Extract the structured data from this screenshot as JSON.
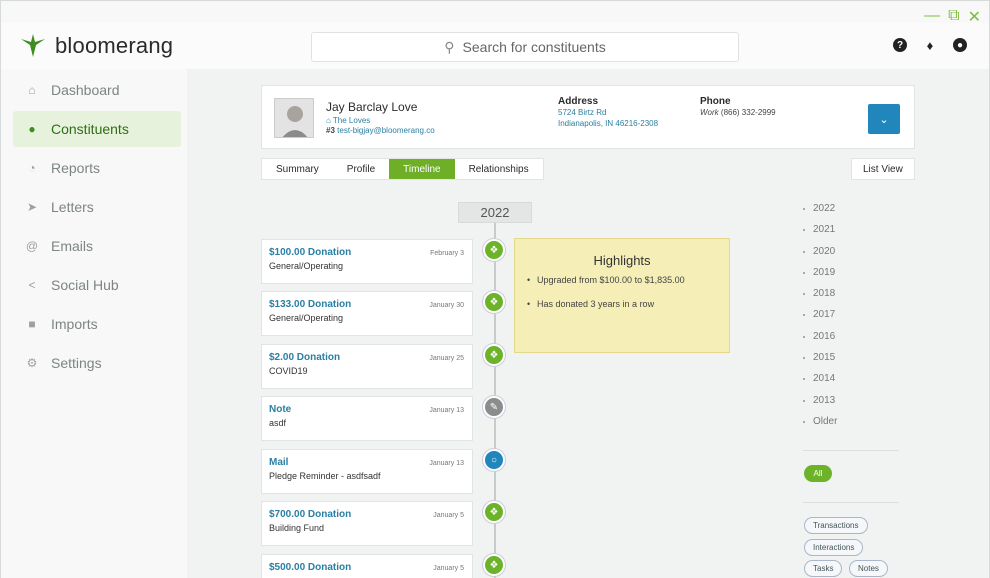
{
  "window": {
    "minimize": "—",
    "restore": "⧉",
    "close": "✕"
  },
  "app": {
    "logo_text": "bloomerang"
  },
  "search": {
    "placeholder": "Search for constituents"
  },
  "sidebar": {
    "items": [
      {
        "label": "Dashboard",
        "icon": "home-icon"
      },
      {
        "label": "Constituents",
        "icon": "people-icon",
        "active": true
      },
      {
        "label": "Reports",
        "icon": "pie-icon"
      },
      {
        "label": "Letters",
        "icon": "send-icon"
      },
      {
        "label": "Emails",
        "icon": "at-icon"
      },
      {
        "label": "Social Hub",
        "icon": "share-icon"
      },
      {
        "label": "Imports",
        "icon": "import-icon"
      },
      {
        "label": "Settings",
        "icon": "gear-icon"
      }
    ]
  },
  "constituent": {
    "name": "Jay Barclay Love",
    "household": "The Loves",
    "id": "#3",
    "email": "test-bigjay@bloomerang.co",
    "address_label": "Address",
    "address_line1": "5724 Birtz Rd",
    "address_line2": "Indianapolis, IN 46216-2308",
    "phone_label": "Phone",
    "phone_type": "Work",
    "phone": "(866) 332-2999"
  },
  "tabs": [
    "Summary",
    "Profile",
    "Timeline",
    "Relationships"
  ],
  "list_view": "List View",
  "timeline": {
    "year": "2022",
    "entries": [
      {
        "title": "$100.00 Donation",
        "date": "February 3",
        "sub": "General/Operating",
        "type": "gift"
      },
      {
        "title": "$133.00 Donation",
        "date": "January 30",
        "sub": "General/Operating",
        "type": "gift"
      },
      {
        "title": "$2.00 Donation",
        "date": "January 25",
        "sub": "COVID19",
        "type": "gift"
      },
      {
        "title": "Note",
        "date": "January 13",
        "sub": "asdf",
        "type": "note"
      },
      {
        "title": "Mail",
        "date": "January 13",
        "sub": "Pledge Reminder - asdfsadf",
        "type": "mail"
      },
      {
        "title": "$700.00 Donation",
        "date": "January 5",
        "sub": "Building Fund",
        "type": "gift"
      },
      {
        "title": "$500.00 Donation",
        "date": "January 5",
        "sub": "",
        "type": "gift"
      }
    ]
  },
  "highlights": {
    "title": "Highlights",
    "items": [
      "Upgraded from $100.00 to $1,835.00",
      "Has donated 3 years in a row"
    ]
  },
  "years": [
    "2022",
    "2021",
    "2020",
    "2019",
    "2018",
    "2017",
    "2016",
    "2015",
    "2014",
    "2013",
    "Older"
  ],
  "filters": {
    "all": "All",
    "pills": [
      "Transactions",
      "Interactions",
      "Tasks",
      "Notes"
    ]
  }
}
